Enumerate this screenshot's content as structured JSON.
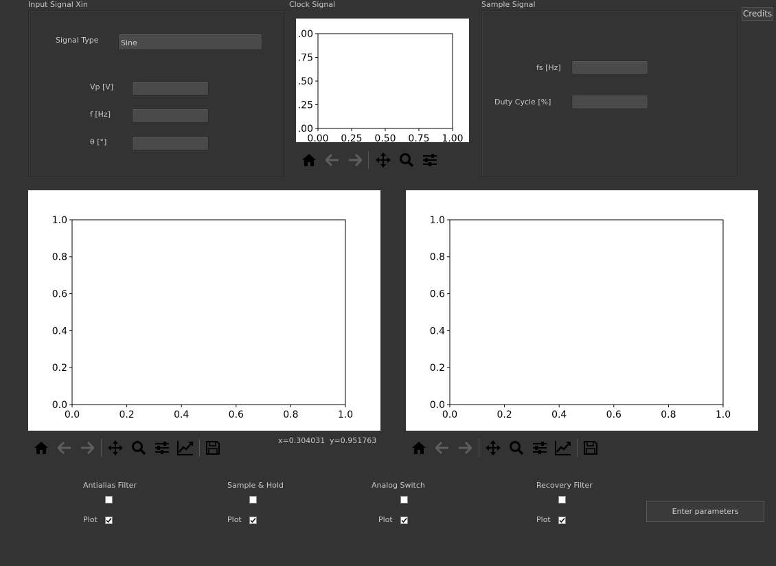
{
  "input_group": {
    "title": "Input Signal Xin",
    "signal_type_label": "Signal Type",
    "signal_type_value": "Sine",
    "vp_label": "Vp [V]",
    "f_label": "f [Hz]",
    "theta_label": "θ [°]"
  },
  "clock_group": {
    "title": "Clock Signal",
    "x_ticks": [
      "0.00",
      "0.25",
      "0.50",
      "0.75",
      "1.00"
    ],
    "y_ticks": [
      ".00",
      ".25",
      ".50",
      ".75",
      ".00"
    ]
  },
  "sample_group": {
    "title": "Sample Signal",
    "fs_label": "fs [Hz]",
    "duty_label": "Duty Cycle [%]"
  },
  "credits_button": "Credits",
  "plot_left": {
    "x_ticks": [
      "0.0",
      "0.2",
      "0.4",
      "0.6",
      "0.8",
      "1.0"
    ],
    "y_ticks": [
      "0.0",
      "0.2",
      "0.4",
      "0.6",
      "0.8",
      "1.0"
    ]
  },
  "plot_right": {
    "x_ticks": [
      "0.0",
      "0.2",
      "0.4",
      "0.6",
      "0.8",
      "1.0"
    ],
    "y_ticks": [
      "0.0",
      "0.2",
      "0.4",
      "0.6",
      "0.8",
      "1.0"
    ]
  },
  "cursor_readout": {
    "x": "x=0.304031",
    "y": "y=0.951763"
  },
  "stages": [
    {
      "name": "Antialias Filter",
      "enabled": false,
      "plot_label": "Plot",
      "plot": true
    },
    {
      "name": "Sample & Hold",
      "enabled": false,
      "plot_label": "Plot",
      "plot": true
    },
    {
      "name": "Analog Switch",
      "enabled": false,
      "plot_label": "Plot",
      "plot": true
    },
    {
      "name": "Recovery Filter",
      "enabled": false,
      "plot_label": "Plot",
      "plot": true
    }
  ],
  "enter_button": "Enter parameters",
  "icons": {
    "toolbar_small": [
      "home-icon",
      "back-arrow-icon",
      "forward-arrow-icon",
      "pan-icon",
      "zoom-icon",
      "configure-subplots-icon"
    ],
    "toolbar_full": [
      "home-icon",
      "back-arrow-icon",
      "forward-arrow-icon",
      "pan-icon",
      "zoom-icon",
      "configure-subplots-icon",
      "edit-axis-icon",
      "save-icon"
    ]
  },
  "colors": {
    "background": "#333333",
    "field": "#4a4a4a",
    "text": "#c8c8c8",
    "plot_bg": "#ffffff"
  },
  "chart_data": [
    {
      "type": "line",
      "series": [],
      "xlim": [
        0,
        1
      ],
      "ylim": [
        0,
        1
      ],
      "title": "",
      "xlabel": "",
      "ylabel": ""
    },
    {
      "type": "line",
      "series": [],
      "xlim": [
        0,
        1
      ],
      "ylim": [
        0,
        1
      ],
      "title": "",
      "xlabel": "",
      "ylabel": ""
    },
    {
      "type": "line",
      "series": [],
      "xlim": [
        0,
        1
      ],
      "ylim": [
        0,
        1
      ],
      "title": "",
      "xlabel": "",
      "ylabel": ""
    }
  ]
}
